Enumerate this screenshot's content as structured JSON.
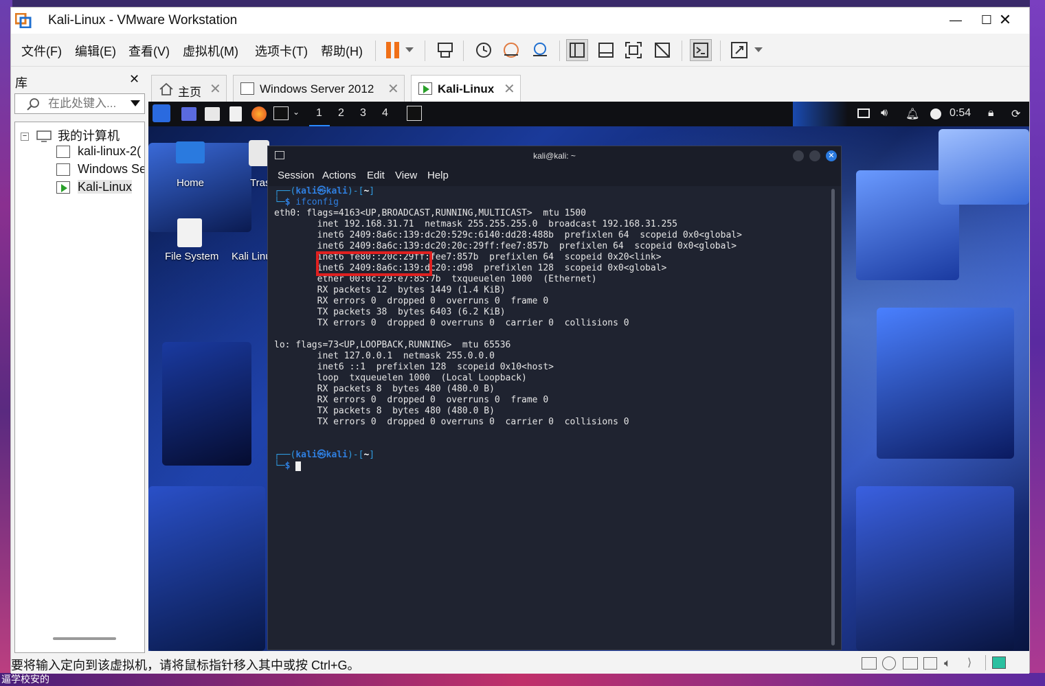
{
  "window": {
    "title": "Kali-Linux - VMware Workstation"
  },
  "menu": {
    "file": "文件(F)",
    "edit": "编辑(E)",
    "view": "查看(V)",
    "vm": "虚拟机(M)",
    "tabs": "选项卡(T)",
    "help": "帮助(H)"
  },
  "library": {
    "title": "库",
    "search_placeholder": "在此处键入...",
    "root": "我的计算机",
    "items": [
      {
        "label": "kali-linux-2("
      },
      {
        "label": "Windows Se"
      },
      {
        "label": "Kali-Linux"
      }
    ]
  },
  "tabs": [
    {
      "label": "主页"
    },
    {
      "label": "Windows Server 2012"
    },
    {
      "label": "Kali-Linux"
    }
  ],
  "kali_panel": {
    "workspaces": [
      "1",
      "2",
      "3",
      "4"
    ],
    "clock": "0:54"
  },
  "desktop_icons": {
    "home": "Home",
    "trash": "Tras",
    "filesystem": "File System",
    "kali": "Kali Linu"
  },
  "terminal": {
    "title": "kali@kali: ~",
    "menu": [
      "Session",
      "Actions",
      "Edit",
      "View",
      "Help"
    ],
    "prompt_user": "kali",
    "prompt_at": "㉿",
    "prompt_host": "kali",
    "prompt_dir": "~",
    "command": "ifconfig",
    "lines": [
      "eth0: flags=4163<UP,BROADCAST,RUNNING,MULTICAST>  mtu 1500",
      "        inet 192.168.31.71  netmask 255.255.255.0  broadcast 192.168.31.255",
      "        inet6 2409:8a6c:139:dc20:529c:6140:dd28:488b  prefixlen 64  scopeid 0x0<global>",
      "        inet6 2409:8a6c:139:dc20:20c:29ff:fee7:857b  prefixlen 64  scopeid 0x0<global>",
      "        inet6 fe80::20c:29ff:fee7:857b  prefixlen 64  scopeid 0x20<link>",
      "        inet6 2409:8a6c:139:dc20::d98  prefixlen 128  scopeid 0x0<global>",
      "        ether 00:0c:29:e7:85:7b  txqueuelen 1000  (Ethernet)",
      "        RX packets 12  bytes 1449 (1.4 KiB)",
      "        RX errors 0  dropped 0  overruns 0  frame 0",
      "        TX packets 38  bytes 6403 (6.2 KiB)",
      "        TX errors 0  dropped 0 overruns 0  carrier 0  collisions 0",
      "",
      "lo: flags=73<UP,LOOPBACK,RUNNING>  mtu 65536",
      "        inet 127.0.0.1  netmask 255.0.0.0",
      "        inet6 ::1  prefixlen 128  scopeid 0x10<host>",
      "        loop  txqueuelen 1000  (Local Loopback)",
      "        RX packets 8  bytes 480 (480.0 B)",
      "        RX errors 0  dropped 0  overruns 0  frame 0",
      "        TX packets 8  bytes 480 (480.0 B)",
      "        TX errors 0  dropped 0 overruns 0  carrier 0  collisions 0"
    ]
  },
  "status": {
    "message": "要将输入定向到该虚拟机，请将鼠标指针移入其中或按 Ctrl+G。"
  },
  "outer_desktop": {
    "bottom_text": "逼学校安的"
  },
  "colors": {
    "highlight_box": "#e02020",
    "prompt_blue": "#2f7fe0",
    "terminal_bg": "#1f2330"
  }
}
